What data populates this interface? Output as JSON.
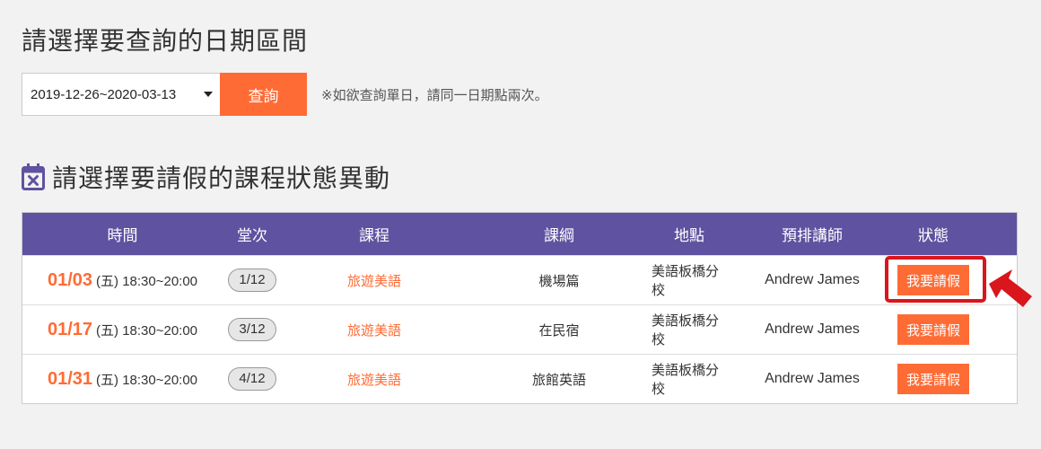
{
  "header": {
    "title": "請選擇要查詢的日期區間"
  },
  "query": {
    "date_range": "2019-12-26~2020-03-13",
    "button_label": "查詢",
    "note": "※如欲查詢單日，請同一日期點兩次。"
  },
  "section": {
    "title": "請選擇要請假的課程狀態異動",
    "icon": "calendar-x-icon"
  },
  "table": {
    "columns": [
      "時間",
      "堂次",
      "課程",
      "課綱",
      "地點",
      "預排講師",
      "狀態"
    ],
    "rows": [
      {
        "date": "01/03",
        "time": "(五) 18:30~20:00",
        "lesson": "1/12",
        "course": "旅遊美語",
        "outline": "機場篇",
        "place": "美語板橋分校",
        "teacher": "Andrew James",
        "action": "我要請假"
      },
      {
        "date": "01/17",
        "time": "(五) 18:30~20:00",
        "lesson": "3/12",
        "course": "旅遊美語",
        "outline": "在民宿",
        "place": "美語板橋分校",
        "teacher": "Andrew James",
        "action": "我要請假"
      },
      {
        "date": "01/31",
        "time": "(五) 18:30~20:00",
        "lesson": "4/12",
        "course": "旅遊美語",
        "outline": "旅館英語",
        "place": "美語板橋分校",
        "teacher": "Andrew James",
        "action": "我要請假"
      }
    ]
  },
  "colors": {
    "accent": "#ff6b35",
    "header_bg": "#5f52a0",
    "highlight": "#d9161c"
  }
}
